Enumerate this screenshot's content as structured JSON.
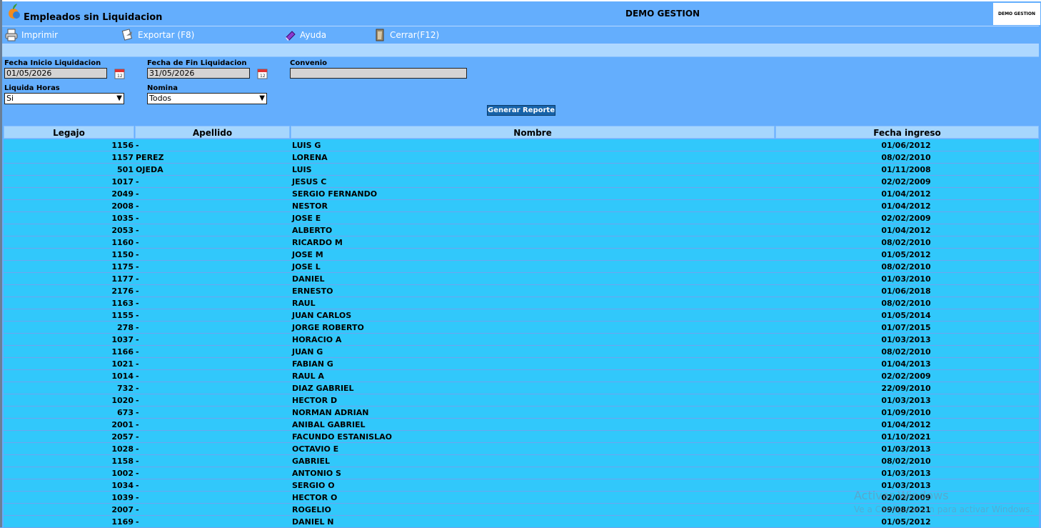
{
  "window": {
    "title": "Empleados sin Liquidacion",
    "company": "DEMO GESTION",
    "logo_text": "DEMO GESTION"
  },
  "toolbar": {
    "print": "Imprimir",
    "export": "Exportar (F8)",
    "help": "Ayuda",
    "close": "Cerrar(F12)"
  },
  "form": {
    "start_label": "Fecha Inicio Liquidacion",
    "start_value": "01/05/2026",
    "end_label": "Fecha de Fin Liquidacion",
    "end_value": "31/05/2026",
    "convenio_label": "Convenio",
    "convenio_value": "",
    "hours_label": "Liquida Horas",
    "hours_value": "Si",
    "nomina_label": "Nomina",
    "nomina_value": "Todos",
    "generate": "Generar Reporte"
  },
  "table": {
    "headers": [
      "Legajo",
      "Apellido",
      "Nombre",
      "Fecha ingreso"
    ],
    "rows": [
      [
        "1156",
        "-",
        "LUIS G",
        "01/06/2012"
      ],
      [
        "1157",
        "PEREZ",
        "LORENA",
        "08/02/2010"
      ],
      [
        "501",
        "OJEDA",
        "LUIS",
        "01/11/2008"
      ],
      [
        "1017",
        "-",
        "JESUS C",
        "02/02/2009"
      ],
      [
        "2049",
        "-",
        "SERGIO FERNANDO",
        "01/04/2012"
      ],
      [
        "2008",
        "-",
        "NESTOR",
        "01/04/2012"
      ],
      [
        "1035",
        "-",
        "JOSE E",
        "02/02/2009"
      ],
      [
        "2053",
        "-",
        "ALBERTO",
        "01/04/2012"
      ],
      [
        "1160",
        "-",
        "RICARDO M",
        "08/02/2010"
      ],
      [
        "1150",
        "-",
        "JOSE M",
        "01/05/2012"
      ],
      [
        "1175",
        "-",
        "JOSE L",
        "08/02/2010"
      ],
      [
        "1177",
        "-",
        "DANIEL",
        "01/03/2010"
      ],
      [
        "2176",
        "-",
        "ERNESTO",
        "01/06/2018"
      ],
      [
        "1163",
        "-",
        "RAUL",
        "08/02/2010"
      ],
      [
        "1155",
        "-",
        "JUAN CARLOS",
        "01/05/2014"
      ],
      [
        "278",
        "-",
        "JORGE ROBERTO",
        "01/07/2015"
      ],
      [
        "1037",
        "-",
        "HORACIO A",
        "01/03/2013"
      ],
      [
        "1166",
        "-",
        "JUAN G",
        "08/02/2010"
      ],
      [
        "1021",
        "-",
        "FABIAN G",
        "01/04/2013"
      ],
      [
        "1014",
        "-",
        "RAUL A",
        "02/02/2009"
      ],
      [
        "732",
        "-",
        "DIAZ GABRIEL",
        "22/09/2010"
      ],
      [
        "1020",
        "-",
        "HECTOR D",
        "01/03/2013"
      ],
      [
        "673",
        "-",
        "NORMAN ADRIAN",
        "01/09/2010"
      ],
      [
        "2001",
        "-",
        "ANIBAL GABRIEL",
        "01/04/2012"
      ],
      [
        "2057",
        "-",
        "FACUNDO ESTANISLAO",
        "01/10/2021"
      ],
      [
        "1028",
        "-",
        "OCTAVIO E",
        "01/03/2013"
      ],
      [
        "1158",
        "-",
        "GABRIEL",
        "08/02/2010"
      ],
      [
        "1002",
        "-",
        "ANTONIO S",
        "01/03/2013"
      ],
      [
        "1034",
        "-",
        "SERGIO O",
        "01/03/2013"
      ],
      [
        "1039",
        "-",
        "HECTOR O",
        "02/02/2009"
      ],
      [
        "2007",
        "-",
        "ROGELIO",
        "09/08/2021"
      ],
      [
        "1169",
        "-",
        "DANIEL N",
        "01/05/2012"
      ]
    ]
  },
  "watermark": {
    "line1": "Activar Windows",
    "line2": "Ve a Configuración para activar Windows."
  }
}
